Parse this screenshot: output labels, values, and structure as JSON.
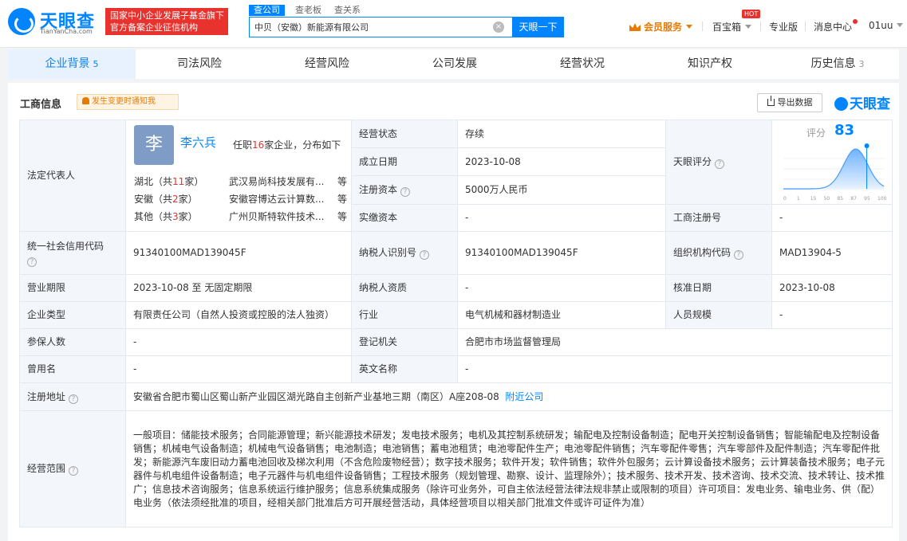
{
  "header": {
    "logo_text": "天眼查",
    "logo_sub": "TianYanCha.com",
    "banner_line1": "国家中小企业发展子基金旗下",
    "banner_line2": "官方备案企业征信机构",
    "search_tabs": [
      "查公司",
      "查老板",
      "查关系"
    ],
    "search_value": "中贝（安徽）新能源有限公司",
    "search_button": "天眼一下",
    "vip_label": "会员服务",
    "baibaoxiang": "百宝箱",
    "hot_badge": "HOT",
    "pro_version": "专业版",
    "messages": "消息中心",
    "user": "01uu"
  },
  "tabs": [
    {
      "label": "企业背景",
      "count": "5"
    },
    {
      "label": "司法风险",
      "count": ""
    },
    {
      "label": "经营风险",
      "count": ""
    },
    {
      "label": "公司发展",
      "count": ""
    },
    {
      "label": "经营状况",
      "count": ""
    },
    {
      "label": "知识产权",
      "count": ""
    },
    {
      "label": "历史信息",
      "count": "3"
    }
  ],
  "section": {
    "title": "工商信息",
    "notify": "发生变更时通知我",
    "export": "导出数据",
    "brand": "天眼查"
  },
  "legal": {
    "label": "法定代表人",
    "avatar_char": "李",
    "name": "李六兵",
    "meta_pre": "任职",
    "meta_count": "16",
    "meta_post": "家企业，分布如下",
    "regions": [
      {
        "region": "湖北",
        "pre": "（共",
        "count": "11",
        "post": "家）",
        "company": "武汉易尚科技发展有...",
        "etc": "等"
      },
      {
        "region": "安徽",
        "pre": "（共",
        "count": "2",
        "post": "家）",
        "company": "安徽容博达云计算数...",
        "etc": "等"
      },
      {
        "region": "其他",
        "pre": "（共",
        "count": "3",
        "post": "家）",
        "company": "广州贝斯特软件技术...",
        "etc": "等"
      }
    ]
  },
  "fields": {
    "status_label": "经营状态",
    "status": "存续",
    "established_label": "成立日期",
    "established": "2023-10-08",
    "reg_capital_label": "注册资本",
    "reg_capital": "5000万人民币",
    "paid_capital_label": "实缴资本",
    "paid_capital": "-",
    "score_label": "天眼评分",
    "reg_no_label": "工商注册号",
    "reg_no": "-",
    "credit_code_label": "统一社会信用代码",
    "credit_code": "91340100MAD139045F",
    "taxpayer_id_label": "纳税人识别号",
    "taxpayer_id": "91340100MAD139045F",
    "org_code_label": "组织机构代码",
    "org_code": "MAD13904-5",
    "term_label": "营业期限",
    "term": "2023-10-08 至 无固定期限",
    "taxpayer_qual_label": "纳税人资质",
    "taxpayer_qual": "-",
    "approval_label": "核准日期",
    "approval": "2023-10-08",
    "type_label": "企业类型",
    "type": "有限责任公司（自然人投资或控股的法人独资）",
    "industry_label": "行业",
    "industry": "电气机械和器材制造业",
    "staff_label": "人员规模",
    "staff": "-",
    "insured_label": "参保人数",
    "insured": "-",
    "authority_label": "登记机关",
    "authority": "合肥市市场监督管理局",
    "former_label": "曾用名",
    "former": "-",
    "english_label": "英文名称",
    "english": "-",
    "address_label": "注册地址",
    "address": "安徽省合肥市蜀山区蜀山新产业园区湖光路自主创新产业基地三期（南区）A座208-08",
    "nearby": "附近公司",
    "scope_label": "经营范围",
    "scope": "一般项目：储能技术服务；合同能源管理；新兴能源技术研发；发电技术服务；电机及其控制系统研发；输配电及控制设备制造；配电开关控制设备销售；智能输配电及控制设备销售；机械电气设备制造；机械电气设备销售；电池制造；电池销售；蓄电池租赁；电池零配件生产；电池零配件销售；汽车零配件零售；汽车零部件及配件制造；汽车零配件批发；新能源汽车废旧动力蓄电池回收及梯次利用（不含危险废物经营）；数字技术服务；软件开发；软件销售；软件外包服务；云计算设备技术服务；云计算装备技术服务；电子元器件与机电组件设备制造；电子元器件与机电组件设备销售；工程技术服务（规划管理、勘察、设计、监理除外）；技术服务、技术开发、技术咨询、技术交流、技术转让、技术推广；信息技术咨询服务；信息系统运行维护服务；信息系统集成服务（除许可业务外，可自主依法经营法律法规非禁止或限制的项目）许可项目：发电业务、输电业务、供（配）电业务（依法须经批准的项目，经相关部门批准后方可开展经营活动，具体经营项目以相关部门批准文件或许可证件为准）"
  },
  "score": {
    "label": "评分",
    "value": 83,
    "ticks": [
      "0",
      "1",
      "15",
      "50",
      "85",
      "87",
      "95",
      "100"
    ],
    "accent": "#0084ff"
  }
}
